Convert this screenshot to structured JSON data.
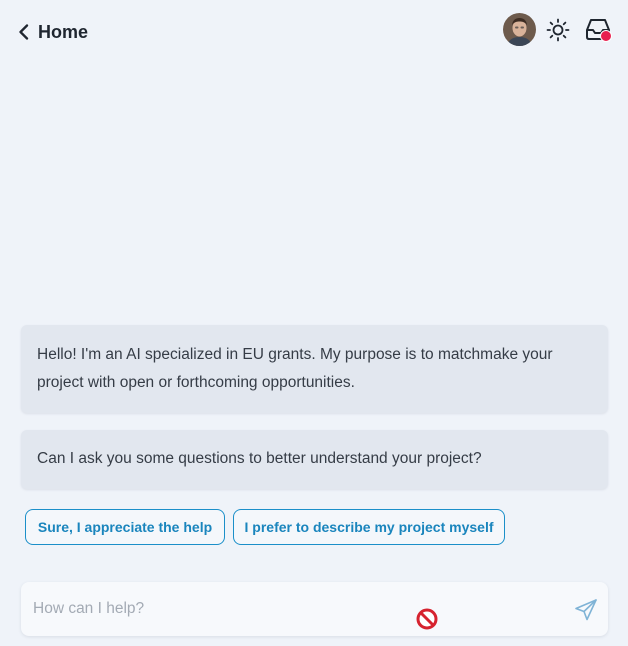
{
  "header": {
    "back_label": "Home",
    "back_icon": "chevron-left-icon",
    "avatar_icon": "user-avatar",
    "theme_icon": "sun-icon",
    "inbox_icon": "inbox-icon",
    "inbox_badge_color": "#e8204f"
  },
  "messages": [
    {
      "text": "Hello! I'm an AI specialized in EU grants. My purpose is to matchmake your project with open or forthcoming opportunities."
    },
    {
      "text": "Can I ask you some questions to better understand your project?"
    }
  ],
  "options": [
    {
      "label": "Sure, I appreciate the help"
    },
    {
      "label": "I prefer to describe my project myself"
    }
  ],
  "chat_input": {
    "placeholder": "How can I help?",
    "value": "",
    "send_icon": "send-icon"
  },
  "colors": {
    "background": "#eff3f9",
    "bubble": "#e2e7ef",
    "accent": "#1b8fc9"
  }
}
